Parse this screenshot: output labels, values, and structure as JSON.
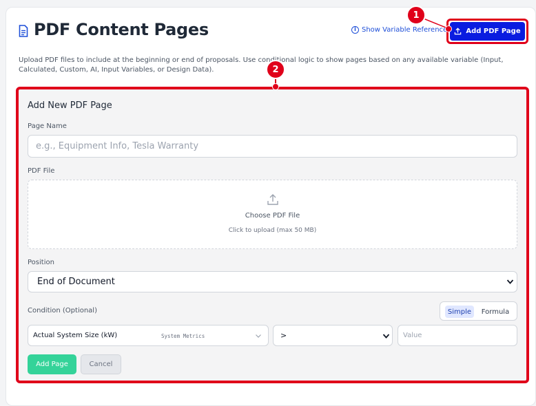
{
  "header": {
    "title": "PDF Content Pages",
    "variable_reference_label": "Show Variable Reference",
    "add_button_label": "Add PDF Page"
  },
  "description": "Upload PDF files to include at the beginning or end of proposals. Use conditional logic to show pages based on any available variable (Input, Calculated, Custom, AI, Input Variables, or Design Data).",
  "annotations": {
    "badge_1": "1",
    "badge_2": "2",
    "highlight_color": "#e0001a"
  },
  "form": {
    "heading": "Add New PDF Page",
    "page_name": {
      "label": "Page Name",
      "placeholder": "e.g., Equipment Info, Tesla Warranty"
    },
    "pdf_file": {
      "label": "PDF File",
      "upload_title": "Choose PDF File",
      "upload_hint": "Click to upload (max 50 MB)",
      "icon": "upload-icon"
    },
    "position": {
      "label": "Position",
      "selected": "End of Document"
    },
    "condition": {
      "label": "Condition (Optional)",
      "mode_simple": "Simple",
      "mode_formula": "Formula",
      "active_mode": "Simple",
      "variable": "Actual System Size (kW)",
      "variable_category": "System Metrics",
      "operator": ">",
      "value_placeholder": "Value"
    },
    "add_button_label": "Add Page",
    "cancel_button_label": "Cancel"
  },
  "colors": {
    "primary_button": "#0a1ce0",
    "add_page_button": "#34d399",
    "link": "#1d4ed8"
  }
}
